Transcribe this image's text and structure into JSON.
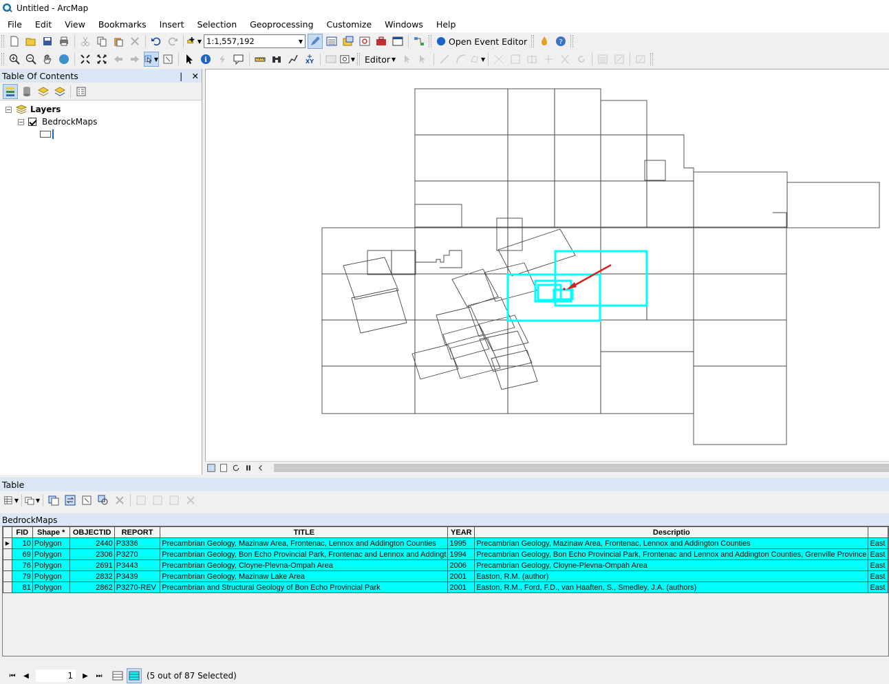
{
  "window": {
    "title": "Untitled - ArcMap"
  },
  "menu": [
    "File",
    "Edit",
    "View",
    "Bookmarks",
    "Insert",
    "Selection",
    "Geoprocessing",
    "Customize",
    "Windows",
    "Help"
  ],
  "toolbar": {
    "scale": "1:1,557,192",
    "open_event_editor": "Open Event Editor",
    "editor": "Editor"
  },
  "toc": {
    "title": "Table Of Contents",
    "pin_glyph": "❘",
    "close_glyph": "✕",
    "root": "Layers",
    "layer": "BedrockMaps"
  },
  "table": {
    "title": "Table",
    "tab": "BedrockMaps",
    "columns": [
      "FID",
      "Shape *",
      "OBJECTID",
      "REPORT",
      "TITLE",
      "YEAR",
      "Descriptio",
      ""
    ],
    "rows": [
      [
        "10",
        "Polygon",
        "2440",
        "P3336",
        "Precambrian Geology, Mazinaw Area, Frontenac, Lennox and Addington Counties",
        "1995",
        "Precambrian Geology, Mazinaw Area, Frontenac, Lennox and Addington Counties",
        "East"
      ],
      [
        "69",
        "Polygon",
        "2306",
        "P3270",
        "Precambrian Geology, Bon Echo Provincial Park, Frontenac and Lennox and Addingt",
        "1994",
        "Precambrian Geology, Bon Echo Provincial Park, Frontenac and Lennox and Addington Counties, Grenville Province",
        "East"
      ],
      [
        "76",
        "Polygon",
        "2691",
        "P3443",
        "Precambrian Geology, Cloyne-Plevna-Ompah Area",
        "2006",
        "Precambrian Geology, Cloyne-Plevna-Ompah Area",
        "East"
      ],
      [
        "79",
        "Polygon",
        "2832",
        "P3439",
        "Precambrian Geology, Mazinaw Lake Area",
        "2001",
        "Easton, R.M. (author)",
        "East"
      ],
      [
        "81",
        "Polygon",
        "2862",
        "P3270-REV",
        "Precambrian and Structural Geology of Bon Echo Provincial Park",
        "2001",
        "Easton, R.M., Ford, F.D., van Haaften, S., Smedley, J.A. (authors)",
        "East"
      ]
    ],
    "record": "1",
    "status": "(5 out of 87 Selected)"
  },
  "colors": {
    "selection": "#00ffff",
    "arrow": "#d62020",
    "panel_header": "#dbe7f4"
  }
}
